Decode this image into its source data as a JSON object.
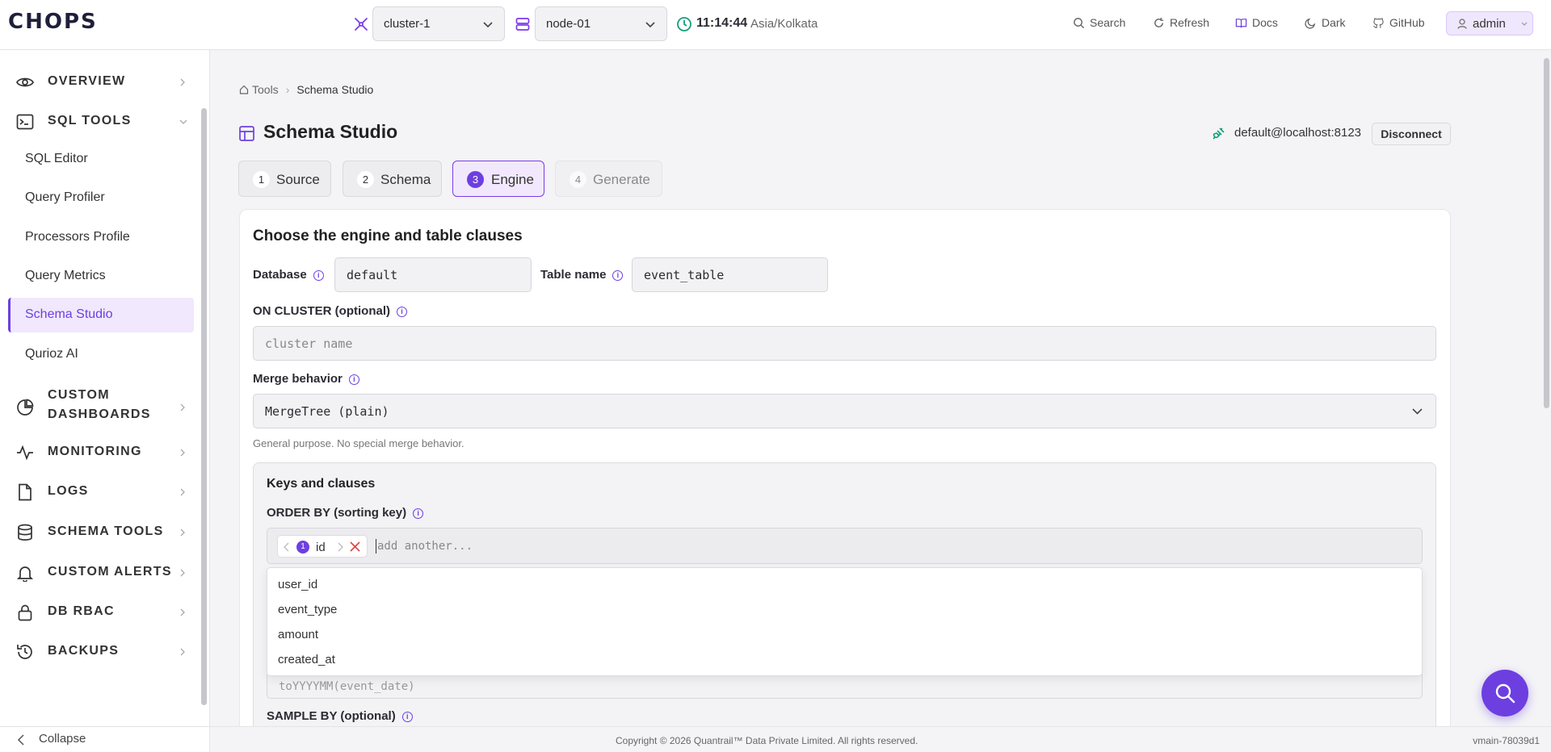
{
  "brand": {
    "name": "CHOPS"
  },
  "topbar": {
    "cluster": "cluster-1",
    "node": "node-01",
    "time": "11:14:44",
    "timezone": "Asia/Kolkata",
    "links": [
      "Search",
      "Refresh",
      "Docs",
      "Dark",
      "GitHub"
    ],
    "user": "admin"
  },
  "sidebar": {
    "items": [
      {
        "label": "OVERVIEW",
        "icon": "eye-icon"
      },
      {
        "label": "SQL TOOLS",
        "icon": "terminal-icon"
      },
      {
        "label": "CUSTOM DASHBOARDS",
        "icon": "pie-chart-icon"
      },
      {
        "label": "MONITORING",
        "icon": "activity-icon"
      },
      {
        "label": "LOGS",
        "icon": "file-icon"
      },
      {
        "label": "SCHEMA TOOLS",
        "icon": "database-icon"
      },
      {
        "label": "CUSTOM ALERTS",
        "icon": "bell-icon"
      },
      {
        "label": "DB RBAC",
        "icon": "lock-icon"
      },
      {
        "label": "BACKUPS",
        "icon": "history-icon"
      }
    ],
    "sql_sub": [
      "SQL Editor",
      "Query Profiler",
      "Processors Profile",
      "Query Metrics",
      "Schema Studio",
      "Qurioz AI"
    ],
    "custom_dash_line1": "CUSTOM",
    "custom_dash_line2": "DASHBOARDS",
    "collapse": "Collapse"
  },
  "breadcrumb": {
    "root": "Tools",
    "current": "Schema Studio"
  },
  "page": {
    "title": "Schema Studio",
    "connection": "default@localhost:8123",
    "disconnect": "Disconnect"
  },
  "steps": [
    {
      "num": "1",
      "label": "Source"
    },
    {
      "num": "2",
      "label": "Schema"
    },
    {
      "num": "3",
      "label": "Engine"
    },
    {
      "num": "4",
      "label": "Generate"
    }
  ],
  "form": {
    "heading": "Choose the engine and table clauses",
    "database_label": "Database",
    "database_value": "default",
    "table_label": "Table name",
    "table_value": "event_table",
    "cluster_label": "ON CLUSTER (optional)",
    "cluster_placeholder": "cluster name",
    "merge_label": "Merge behavior",
    "merge_value": "MergeTree (plain)",
    "merge_hint": "General purpose. No special merge behavior.",
    "keys_heading": "Keys and clauses",
    "order_label": "ORDER BY (sorting key)",
    "order_chip_num": "1",
    "order_chip_value": "id",
    "order_add_placeholder": "add another...",
    "order_options": [
      "user_id",
      "event_type",
      "amount",
      "created_at"
    ],
    "partition_placeholder": "toYYYYMM(event_date)",
    "sample_label": "SAMPLE BY (optional)"
  },
  "footer": {
    "copyright": "Copyright © 2026 Quantrail™ Data Private Limited. All rights reserved.",
    "version": "vmain-78039d1"
  },
  "colors": {
    "accent": "#6d3fe0",
    "active_bg": "#f1e8fd"
  }
}
